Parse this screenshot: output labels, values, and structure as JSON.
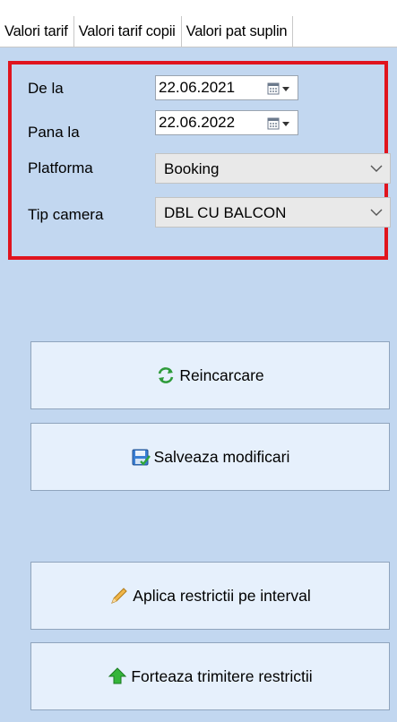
{
  "tabs": [
    {
      "label": "Valori tarif"
    },
    {
      "label": "Valori tarif copii"
    },
    {
      "label": "Valori pat suplin"
    }
  ],
  "filters": {
    "from_label": "De la",
    "from_value": "22.06.2021",
    "to_label": "Pana la",
    "to_value": "22.06.2022",
    "platform_label": "Platforma",
    "platform_value": "Booking",
    "room_label": "Tip camera",
    "room_value": "DBL CU BALCON"
  },
  "buttons": {
    "reload": {
      "label": "Reincarcare",
      "icon": "refresh-arrows-icon"
    },
    "save": {
      "label": "Salveaza modificari",
      "icon": "save-disk-icon"
    },
    "apply": {
      "label": "Aplica restrictii pe interval",
      "icon": "pencil-icon"
    },
    "force": {
      "label": "Forteaza trimitere restrictii",
      "icon": "green-up-arrow-icon"
    }
  },
  "colors": {
    "panel_bg": "#c2d7f0",
    "highlight_border": "#e0141e",
    "button_bg": "#e6f0fc"
  }
}
